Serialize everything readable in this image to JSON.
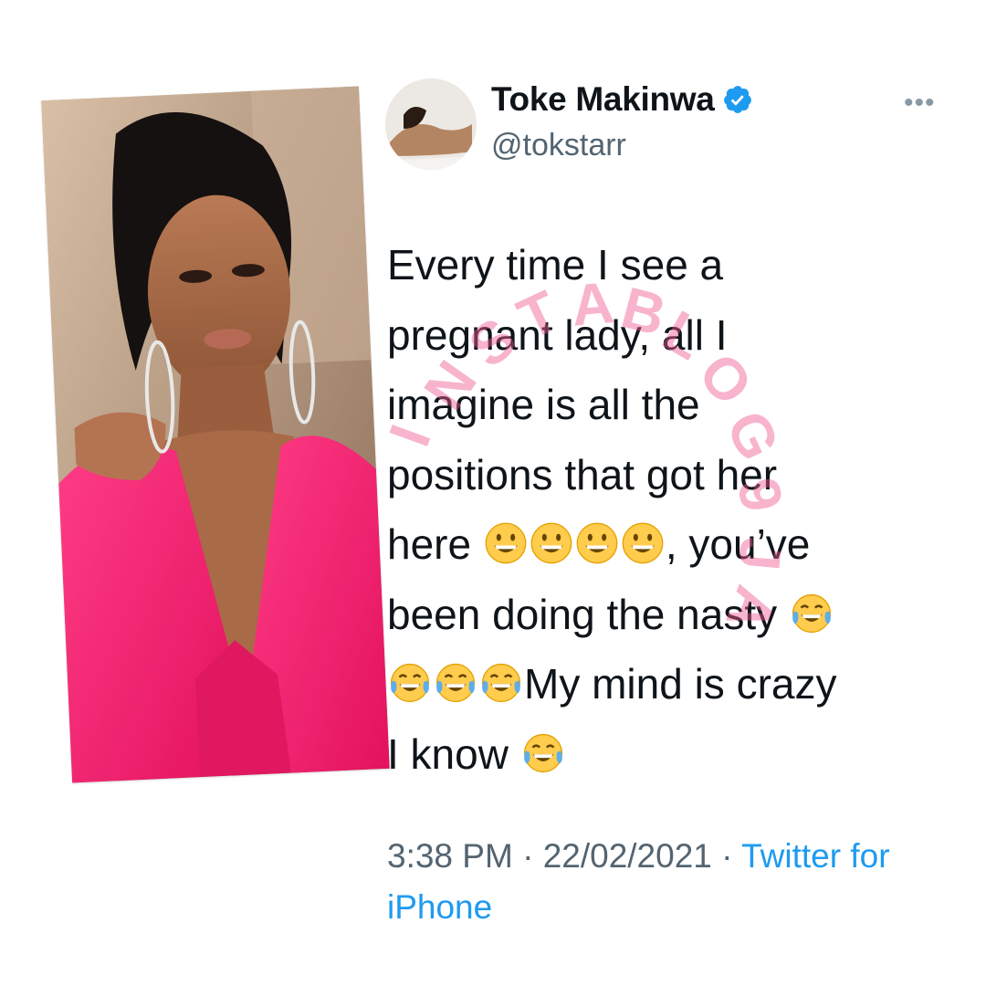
{
  "tweet": {
    "display_name": "Toke Makinwa",
    "handle": "@tokstarr",
    "verified_icon": "verified-badge-icon",
    "more_icon": "more-options-icon",
    "text_segments": [
      "Every time I see a\npregnant lady, all I\nimagine is all the\npositions that got her\nhere ",
      ", you’ve\nbeen doing the nasty ",
      "My mind is crazy\nI know "
    ],
    "time": "3:38 PM",
    "date": "22/02/2021",
    "separator": "·",
    "source": "Twitter for iPhone"
  },
  "watermark": {
    "letters": [
      "I",
      "N",
      "S",
      "T",
      "A",
      "B",
      "L",
      "O",
      "G",
      "9",
      "J",
      "A"
    ]
  },
  "colors": {
    "accent": "#1d9bf0",
    "text": "#0f1419",
    "secondary": "#536471",
    "watermark": "#f05b92",
    "suit": "#ff2d7a"
  }
}
